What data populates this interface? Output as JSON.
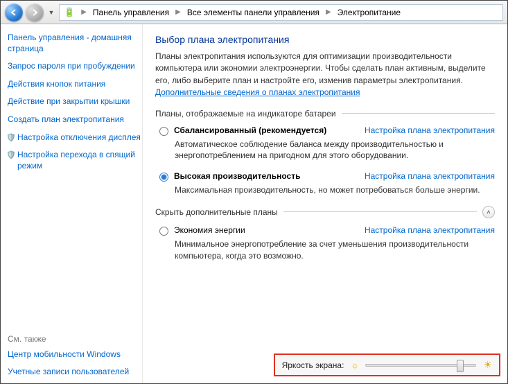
{
  "breadcrumb": {
    "items": [
      "Панель управления",
      "Все элементы панели управления",
      "Электропитание"
    ]
  },
  "sidebar": {
    "links": [
      "Панель управления - домашняя страница",
      "Запрос пароля при пробуждении",
      "Действия кнопок питания",
      "Действие при закрытии крышки",
      "Создать план электропитания",
      "Настройка отключения дисплея",
      "Настройка перехода в спящий режим"
    ],
    "see_also_title": "См. также",
    "see_also": [
      "Центр мобильности Windows",
      "Учетные записи пользователей"
    ]
  },
  "main": {
    "title": "Выбор плана электропитания",
    "intro_text": "Планы электропитания используются для оптимизации производительности компьютера или экономии электроэнергии. Чтобы сделать план активным, выделите его, либо выберите план и настройте его, изменив параметры электропитания. ",
    "intro_link": "Дополнительные сведения о планах электропитания",
    "section1": "Планы, отображаемые на индикаторе батареи",
    "section2": "Скрыть дополнительные планы",
    "plans": [
      {
        "name": "Сбалансированный (рекомендуется)",
        "desc": "Автоматическое соблюдение баланса между производительностью и энергопотреблением на пригодном для этого оборудовании.",
        "link": "Настройка плана электропитания",
        "selected": false
      },
      {
        "name": "Высокая производительность",
        "desc": "Максимальная производительность, но может потребоваться больше энергии.",
        "link": "Настройка плана электропитания",
        "selected": true
      },
      {
        "name": "Экономия энергии",
        "desc": "Минимальное энергопотребление за счет уменьшения производительности компьютера, когда это возможно.",
        "link": "Настройка плана электропитания",
        "selected": false
      }
    ]
  },
  "brightness": {
    "label": "Яркость экрана:",
    "percent": 85
  }
}
